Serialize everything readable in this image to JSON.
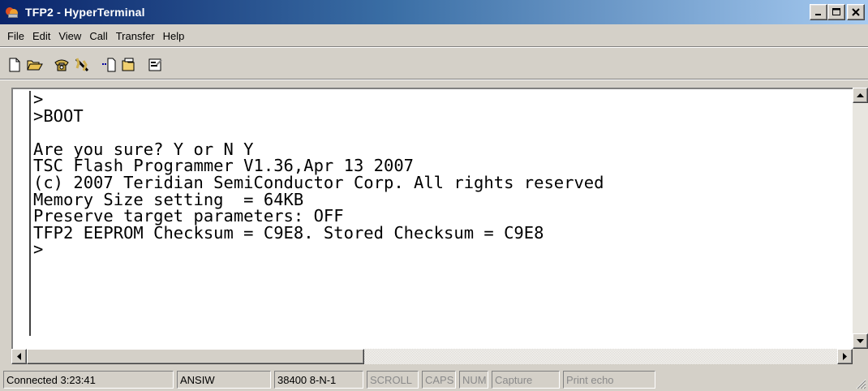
{
  "window": {
    "title": "TFP2 - HyperTerminal",
    "app_icon": "hyperterminal-icon",
    "controls": {
      "minimize": "_",
      "maximize": "□",
      "close": "X"
    }
  },
  "menu": [
    "File",
    "Edit",
    "View",
    "Call",
    "Transfer",
    "Help"
  ],
  "toolbar": [
    {
      "name": "new-icon"
    },
    {
      "name": "open-icon"
    },
    {
      "name": "call-icon"
    },
    {
      "name": "disconnect-icon"
    },
    {
      "name": "send-icon"
    },
    {
      "name": "receive-icon"
    },
    {
      "name": "properties-icon"
    }
  ],
  "terminal": {
    "lines": [
      ">",
      ">BOOT",
      "",
      "Are you sure? Y or N Y",
      "TSC Flash Programmer V1.36,Apr 13 2007",
      "(c) 2007 Teridian SemiConductor Corp. All rights reserved",
      "Memory Size setting  = 64KB",
      "Preserve target parameters: OFF",
      "TFP2 EEPROM Checksum = C9E8. Stored Checksum = C9E8",
      ">"
    ]
  },
  "status": {
    "connected": "Connected 3:23:41",
    "emulation": "ANSIW",
    "settings": "38400 8-N-1",
    "scroll": "SCROLL",
    "caps": "CAPS",
    "num": "NUM",
    "capture": "Capture",
    "print_echo": "Print echo"
  }
}
